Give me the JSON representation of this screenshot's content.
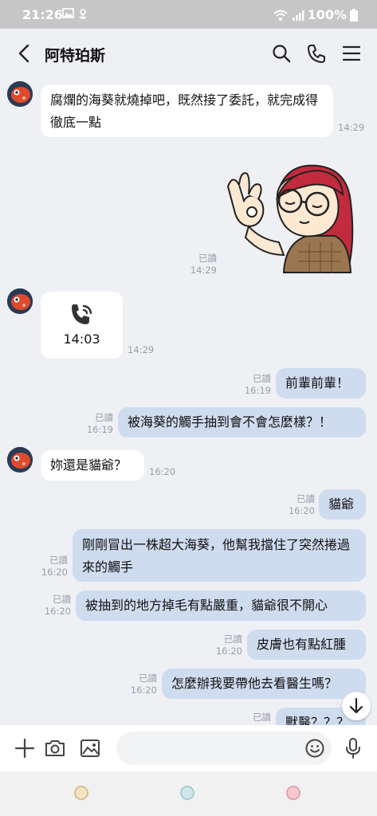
{
  "status_bar": {
    "time": "21:26",
    "battery": "100%"
  },
  "header": {
    "contact_name": "阿特珀斯"
  },
  "messages": {
    "m1": {
      "text": "腐爛的海葵就燒掉吧，既然接了委託，就完成得徹底一點",
      "time": "14:29"
    },
    "m2": {
      "read": "已讀",
      "time": "14:29"
    },
    "m3": {
      "call_duration": "14:03",
      "time": "14:29"
    },
    "m4": {
      "text": "前輩前輩！",
      "read": "已讀",
      "time": "16:19"
    },
    "m5": {
      "text": "被海葵的觸手抽到會不會怎麼樣？！",
      "read": "已讀",
      "time": "16:19"
    },
    "m6": {
      "text": "妳還是貓爺？",
      "time": "16:20"
    },
    "m7": {
      "text": "貓爺",
      "read": "已讀",
      "time": "16:20"
    },
    "m8": {
      "text": "剛剛冒出一株超大海葵，他幫我擋住了突然捲過來的觸手",
      "read": "已讀",
      "time": "16:20"
    },
    "m9": {
      "text": "被抽到的地方掉毛有點嚴重，貓爺很不開心",
      "read": "已讀",
      "time": "16:20"
    },
    "m10": {
      "text": "皮膚也有點紅腫",
      "read": "已讀",
      "time": "16:20"
    },
    "m11": {
      "text": "怎麼辦我要帶他去看醫生嗎？",
      "read": "已讀",
      "time": "16:20"
    },
    "m12": {
      "text": "獸醫？？？",
      "read": "已讀"
    }
  },
  "input": {
    "placeholder": ""
  },
  "colors": {
    "outgoing_bubble": "#cfdcf0",
    "incoming_bubble": "#ffffff",
    "chat_bg": "#eef0f4"
  }
}
